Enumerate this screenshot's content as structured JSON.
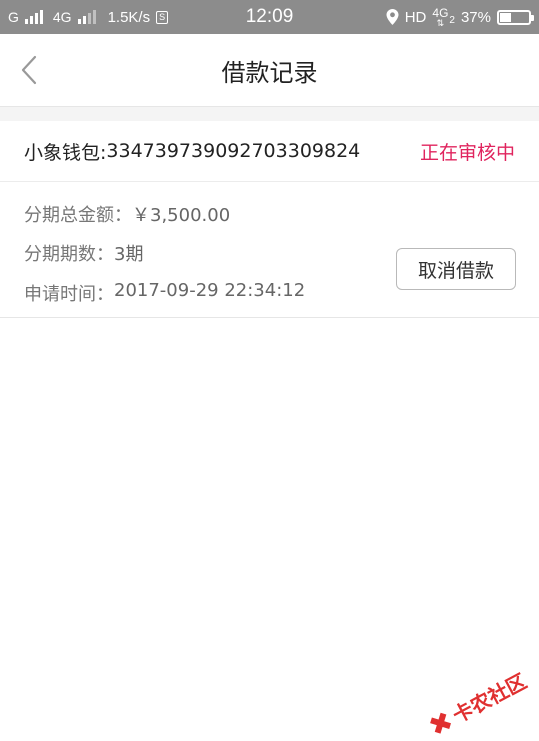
{
  "status_bar": {
    "carrier1": "G",
    "carrier2": "4G",
    "speed": "1.5K/s",
    "s_badge": "S",
    "time": "12:09",
    "hd": "HD",
    "net": "4G",
    "net_sub": "2",
    "battery_pct": "37%",
    "battery_level": 0.37
  },
  "header": {
    "back_icon": "chevron-left-icon",
    "title": "借款记录"
  },
  "record": {
    "wallet_label": "小象钱包: ",
    "wallet_id": "33473973909270330982 4",
    "status": "正在审核中",
    "status_color": "#e0245e",
    "total_label": "分期总金额：",
    "total_value": "￥3,500.00",
    "periods_label": "分期期数：",
    "periods_value": "3期",
    "time_label": "申请时间：",
    "time_value": "2017-09-29 22:34:12",
    "cancel_button": "取消借款"
  },
  "watermark": {
    "text": "卡农社区",
    "color": "#e03030"
  }
}
